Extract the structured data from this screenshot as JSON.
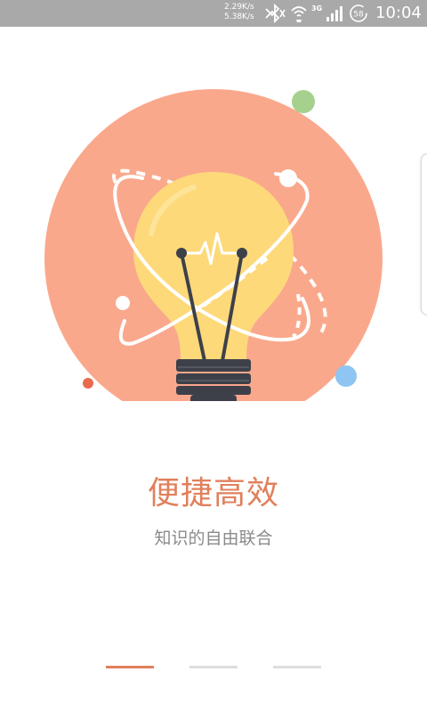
{
  "status_bar": {
    "upload_speed": "2.29K/s",
    "download_speed": "5.38K/s",
    "network_type": "3G",
    "battery_level": "58",
    "time": "10:04",
    "icons": [
      "bluetooth-icon",
      "wifi-icon",
      "signal-icon",
      "battery-icon"
    ]
  },
  "onboarding": {
    "title": "便捷高效",
    "subtitle": "知识的自由联合",
    "illustration": "lightbulb-icon",
    "pages": 3,
    "current_page": 1
  },
  "colors": {
    "accent": "#e0805c",
    "circle": "#faa88c",
    "bulb": "#fdd97a",
    "bulb_base": "#3e4049",
    "green_dot": "#a6d08e",
    "blue_dot": "#8ec5f2",
    "red_dot": "#e96a4d",
    "status_bar": "#a9a9a9"
  }
}
